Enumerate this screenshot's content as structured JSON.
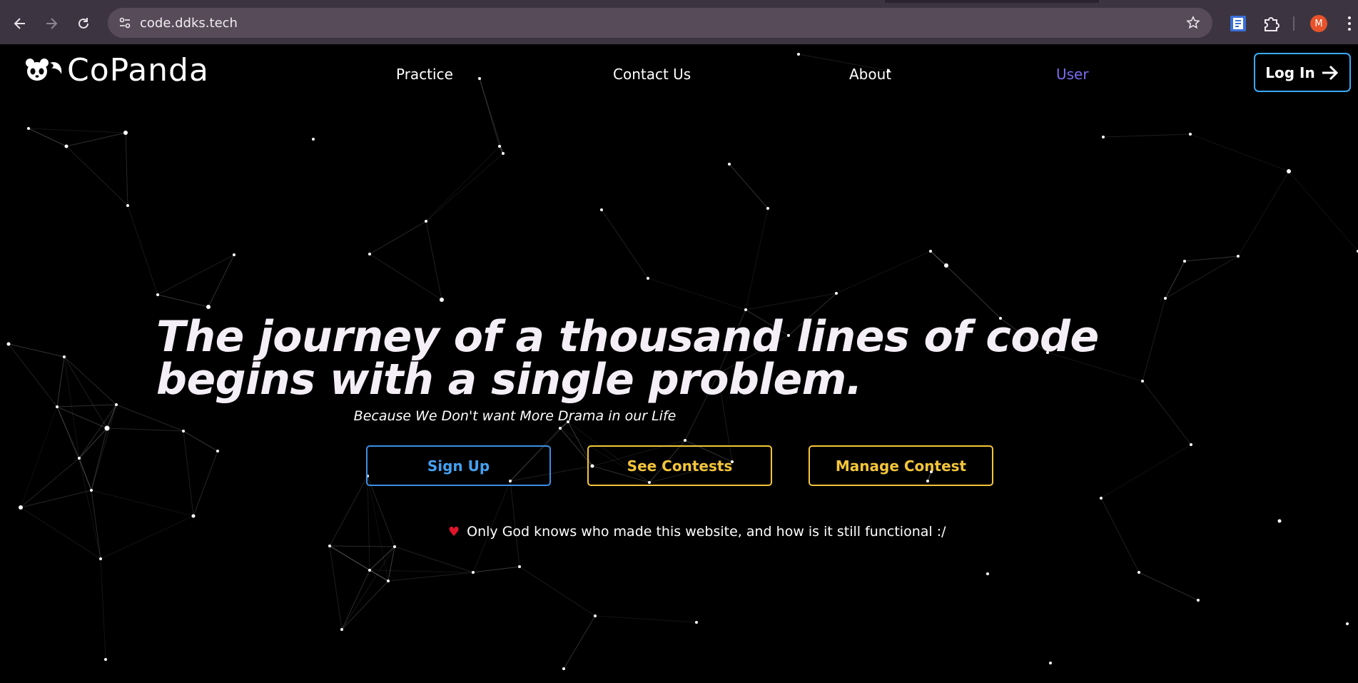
{
  "browser": {
    "url": "code.ddks.tech",
    "back_icon": "arrow-left-icon",
    "forward_icon": "arrow-right-icon",
    "reload_icon": "reload-icon",
    "site_info_icon": "tune-icon",
    "bookmark_icon": "star-icon",
    "extensions_icon": "puzzle-icon",
    "profile_initial": "M",
    "colors": {
      "toolbar": "#3c3541",
      "omnibox": "#574b59",
      "avatar": "#e8532b"
    }
  },
  "site": {
    "brand": "CoPanda",
    "nav": {
      "practice": "Practice",
      "contact": "Contact Us",
      "about": "About",
      "user": "User"
    },
    "login_label": "Log In",
    "headline": "The journey of a thousand lines of code begins with a single problem.",
    "subtitle": "Because We Don't want More Drama in our Life",
    "buttons": {
      "signup": "Sign Up",
      "contests": "See Contests",
      "manage": "Manage Contest"
    },
    "footer_note": "Only God knows who made this website, and how is it still functional :/",
    "colors": {
      "background": "#000000",
      "accent_blue": "#3aa9f5",
      "accent_yellow": "#f3c53a",
      "user_link": "#7b6cf0",
      "heart": "#e3152a"
    }
  }
}
